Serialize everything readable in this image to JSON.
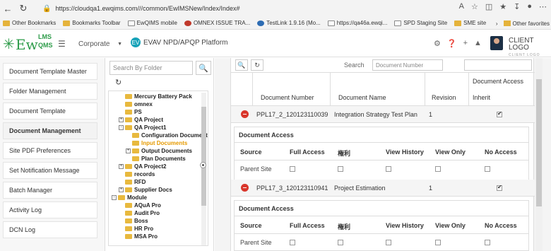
{
  "browser": {
    "url": "https://cloudqa1.ewqims.com///common/EwIMSNew/Index/Index#",
    "bookmarks": [
      {
        "label": "Other Bookmarks",
        "icon": "folder-icon"
      },
      {
        "label": "Bookmarks Toolbar",
        "icon": "folder-icon"
      },
      {
        "label": "EwQIMS mobile",
        "icon": "doc-icon"
      },
      {
        "label": "OMNEX ISSUE TRA...",
        "icon": "omnex-icon"
      },
      {
        "label": "TestLink 1.9.16 (Mo...",
        "icon": "testlink-icon"
      },
      {
        "label": "https://qa46a.ewqi...",
        "icon": "doc-icon"
      },
      {
        "label": "SPD Staging Site",
        "icon": "doc-icon"
      },
      {
        "label": "SME site",
        "icon": "folder-icon"
      }
    ],
    "other_favorites": "Other favorites"
  },
  "header": {
    "logo_ew": "Ew",
    "logo_lms": "LMS",
    "logo_qms": "QMS",
    "corporate_select": "Corporate",
    "platform_badge": "EV",
    "platform_title": "EVAV NPD/APQP Platform",
    "client_logo": "CLIENT LOGO",
    "client_logo_sub": "CLIENT LOGO"
  },
  "sidebar": {
    "items": [
      {
        "label": "Document Template Master",
        "active": false
      },
      {
        "label": "Folder Management",
        "active": false
      },
      {
        "label": "Document Template",
        "active": false
      },
      {
        "label": "Document Management",
        "active": true
      },
      {
        "label": "Site PDF Preferences",
        "active": false
      },
      {
        "label": "Set Notification Message",
        "active": false
      },
      {
        "label": "Batch Manager",
        "active": false
      },
      {
        "label": "Activity Log",
        "active": false
      },
      {
        "label": "DCN Log",
        "active": false
      }
    ]
  },
  "tree": {
    "search_placeholder": "Search By Folder",
    "nodes": [
      {
        "label": "Mercury Battery Pack",
        "level": 1,
        "toggle": "",
        "selected": false
      },
      {
        "label": "omnex",
        "level": 1,
        "toggle": "",
        "selected": false
      },
      {
        "label": "PS",
        "level": 1,
        "toggle": "",
        "selected": false
      },
      {
        "label": "QA Project",
        "level": 1,
        "toggle": "+",
        "selected": false
      },
      {
        "label": "QA Project1",
        "level": 1,
        "toggle": "-",
        "selected": false
      },
      {
        "label": "Configuration Document",
        "level": 2,
        "toggle": "",
        "selected": false
      },
      {
        "label": "Input Documents",
        "level": 2,
        "toggle": "",
        "selected": true
      },
      {
        "label": "Output Documents",
        "level": 2,
        "toggle": "+",
        "selected": false
      },
      {
        "label": "Plan Documents",
        "level": 2,
        "toggle": "",
        "selected": false
      },
      {
        "label": "QA Project2",
        "level": 1,
        "toggle": "+",
        "selected": false
      },
      {
        "label": "records",
        "level": 1,
        "toggle": "",
        "selected": false
      },
      {
        "label": "RFD",
        "level": 1,
        "toggle": "",
        "selected": false
      },
      {
        "label": "Supplier Docs",
        "level": 1,
        "toggle": "+",
        "selected": false
      },
      {
        "label": "Module",
        "level": 0,
        "toggle": "-",
        "selected": false
      },
      {
        "label": "AQuA Pro",
        "level": 1,
        "toggle": "",
        "selected": false
      },
      {
        "label": "Audit Pro",
        "level": 1,
        "toggle": "",
        "selected": false
      },
      {
        "label": "Boss",
        "level": 1,
        "toggle": "",
        "selected": false
      },
      {
        "label": "HR Pro",
        "level": 1,
        "toggle": "",
        "selected": false
      },
      {
        "label": "MSA Pro",
        "level": 1,
        "toggle": "",
        "selected": false
      }
    ]
  },
  "main": {
    "search_label": "Search",
    "search_field_select": "Document Number",
    "columns": {
      "document_number": "Document Number",
      "document_name": "Document Name",
      "revision": "Revision",
      "document_access": "Document Access",
      "inherit": "Inherit"
    },
    "documents": [
      {
        "number": "PPL17_2_120123110039",
        "name": "Integration Strategy Test Plan",
        "revision": "1",
        "inherit": true
      },
      {
        "number": "PPL17_3_120123110941",
        "name": "Project Estimation",
        "revision": "1",
        "inherit": true
      }
    ],
    "access": {
      "title": "Document Access",
      "headers": [
        "Source",
        "Full Access",
        "権利",
        "View History",
        "View Only",
        "No Access"
      ],
      "row_source": "Parent Site"
    }
  }
}
